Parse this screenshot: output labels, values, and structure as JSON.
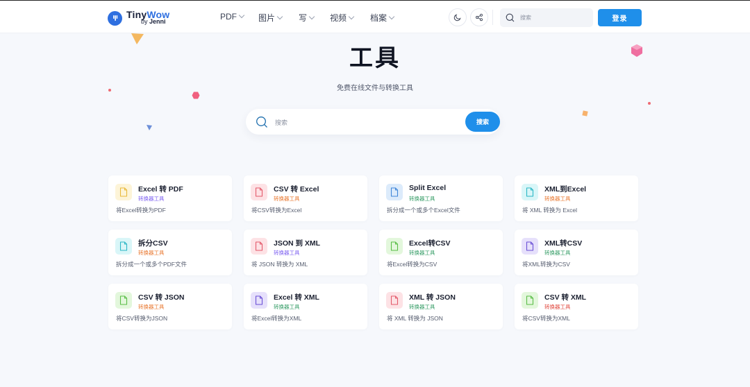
{
  "header": {
    "logo": {
      "main": "Tiny",
      "accent": "Wow",
      "by": "by",
      "brand": "Jenni"
    },
    "nav": [
      {
        "label": "PDF",
        "has_dropdown": true
      },
      {
        "label": "图片",
        "has_dropdown": true
      },
      {
        "label": "写",
        "has_dropdown": true
      },
      {
        "label": "视频",
        "has_dropdown": true
      },
      {
        "label": "档案",
        "has_dropdown": true
      }
    ],
    "theme_toggle_icon": "moon-icon",
    "share_icon": "share-icon",
    "search_placeholder": "搜索",
    "login_label": "登录"
  },
  "hero": {
    "title": "工具",
    "subtitle": "免费在线文件与转换工具",
    "search_placeholder": "搜索",
    "search_button": "搜索"
  },
  "colors": {
    "accent": "#1f8fea",
    "brand": "#2e6fe0",
    "tag_purple": "#7a5cf0",
    "tag_orange": "#e8742a",
    "tag_green": "#2f9a62",
    "tag_red": "#e0453b"
  },
  "tools": [
    {
      "title": "Excel 转 PDF",
      "tag": "转换器工具",
      "tag_color": "#7a5cf0",
      "desc": "将Excel转换为PDF",
      "icon": "file-icon",
      "icon_bg": "#fdf4d8",
      "icon_color": "#e9b93a"
    },
    {
      "title": "CSV 转 Excel",
      "tag": "转换器工具",
      "tag_color": "#e8742a",
      "desc": "将CSV转换为Excel",
      "icon": "file-icon",
      "icon_bg": "#fde2e5",
      "icon_color": "#e45a6b"
    },
    {
      "title": "Split Excel",
      "tag": "转换器工具",
      "tag_color": "#2f9a62",
      "desc": "拆分成一个或多个Excel文件",
      "icon": "file-icon",
      "icon_bg": "#dcebfb",
      "icon_color": "#3f86d8"
    },
    {
      "title": "XML到Excel",
      "tag": "转换器工具",
      "tag_color": "#e8742a",
      "desc": "将 XML 转换为 Excel",
      "icon": "file-icon",
      "icon_bg": "#d9f6f8",
      "icon_color": "#2ab7c5"
    },
    {
      "title": "拆分CSV",
      "tag": "转换器工具",
      "tag_color": "#e8742a",
      "desc": "拆分成一个或多个PDF文件",
      "icon": "file-icon",
      "icon_bg": "#d9f6f8",
      "icon_color": "#2ab7c5"
    },
    {
      "title": "JSON 到 XML",
      "tag": "转换器工具",
      "tag_color": "#7a5cf0",
      "desc": "将 JSON 转换为 XML",
      "icon": "file-icon",
      "icon_bg": "#fde2e5",
      "icon_color": "#e45a6b"
    },
    {
      "title": "Excel转CSV",
      "tag": "转换器工具",
      "tag_color": "#2f9a62",
      "desc": "将Excel转换为CSV",
      "icon": "file-icon",
      "icon_bg": "#e3f7dc",
      "icon_color": "#59bd46"
    },
    {
      "title": "XML转CSV",
      "tag": "转换器工具",
      "tag_color": "#2f9a62",
      "desc": "将XML转换为CSV",
      "icon": "file-icon",
      "icon_bg": "#e6e0fb",
      "icon_color": "#6a4fd6"
    },
    {
      "title": "CSV 转 JSON",
      "tag": "转换器工具",
      "tag_color": "#e8742a",
      "desc": "将CSV转换为JSON",
      "icon": "file-icon",
      "icon_bg": "#e3f7dc",
      "icon_color": "#59bd46"
    },
    {
      "title": "Excel 转 XML",
      "tag": "转换器工具",
      "tag_color": "#2f9a62",
      "desc": "将Excel转换为XML",
      "icon": "file-icon",
      "icon_bg": "#e6e0fb",
      "icon_color": "#6a4fd6"
    },
    {
      "title": "XML 转 JSON",
      "tag": "转换器工具",
      "tag_color": "#2f9a62",
      "desc": "将 XML 转换为 JSON",
      "icon": "file-icon",
      "icon_bg": "#fde2e5",
      "icon_color": "#e45a6b"
    },
    {
      "title": "CSV 转 XML",
      "tag": "转换器工具",
      "tag_color": "#e0453b",
      "desc": "将CSV转换为XML",
      "icon": "file-icon",
      "icon_bg": "#e3f7dc",
      "icon_color": "#59bd46"
    }
  ]
}
